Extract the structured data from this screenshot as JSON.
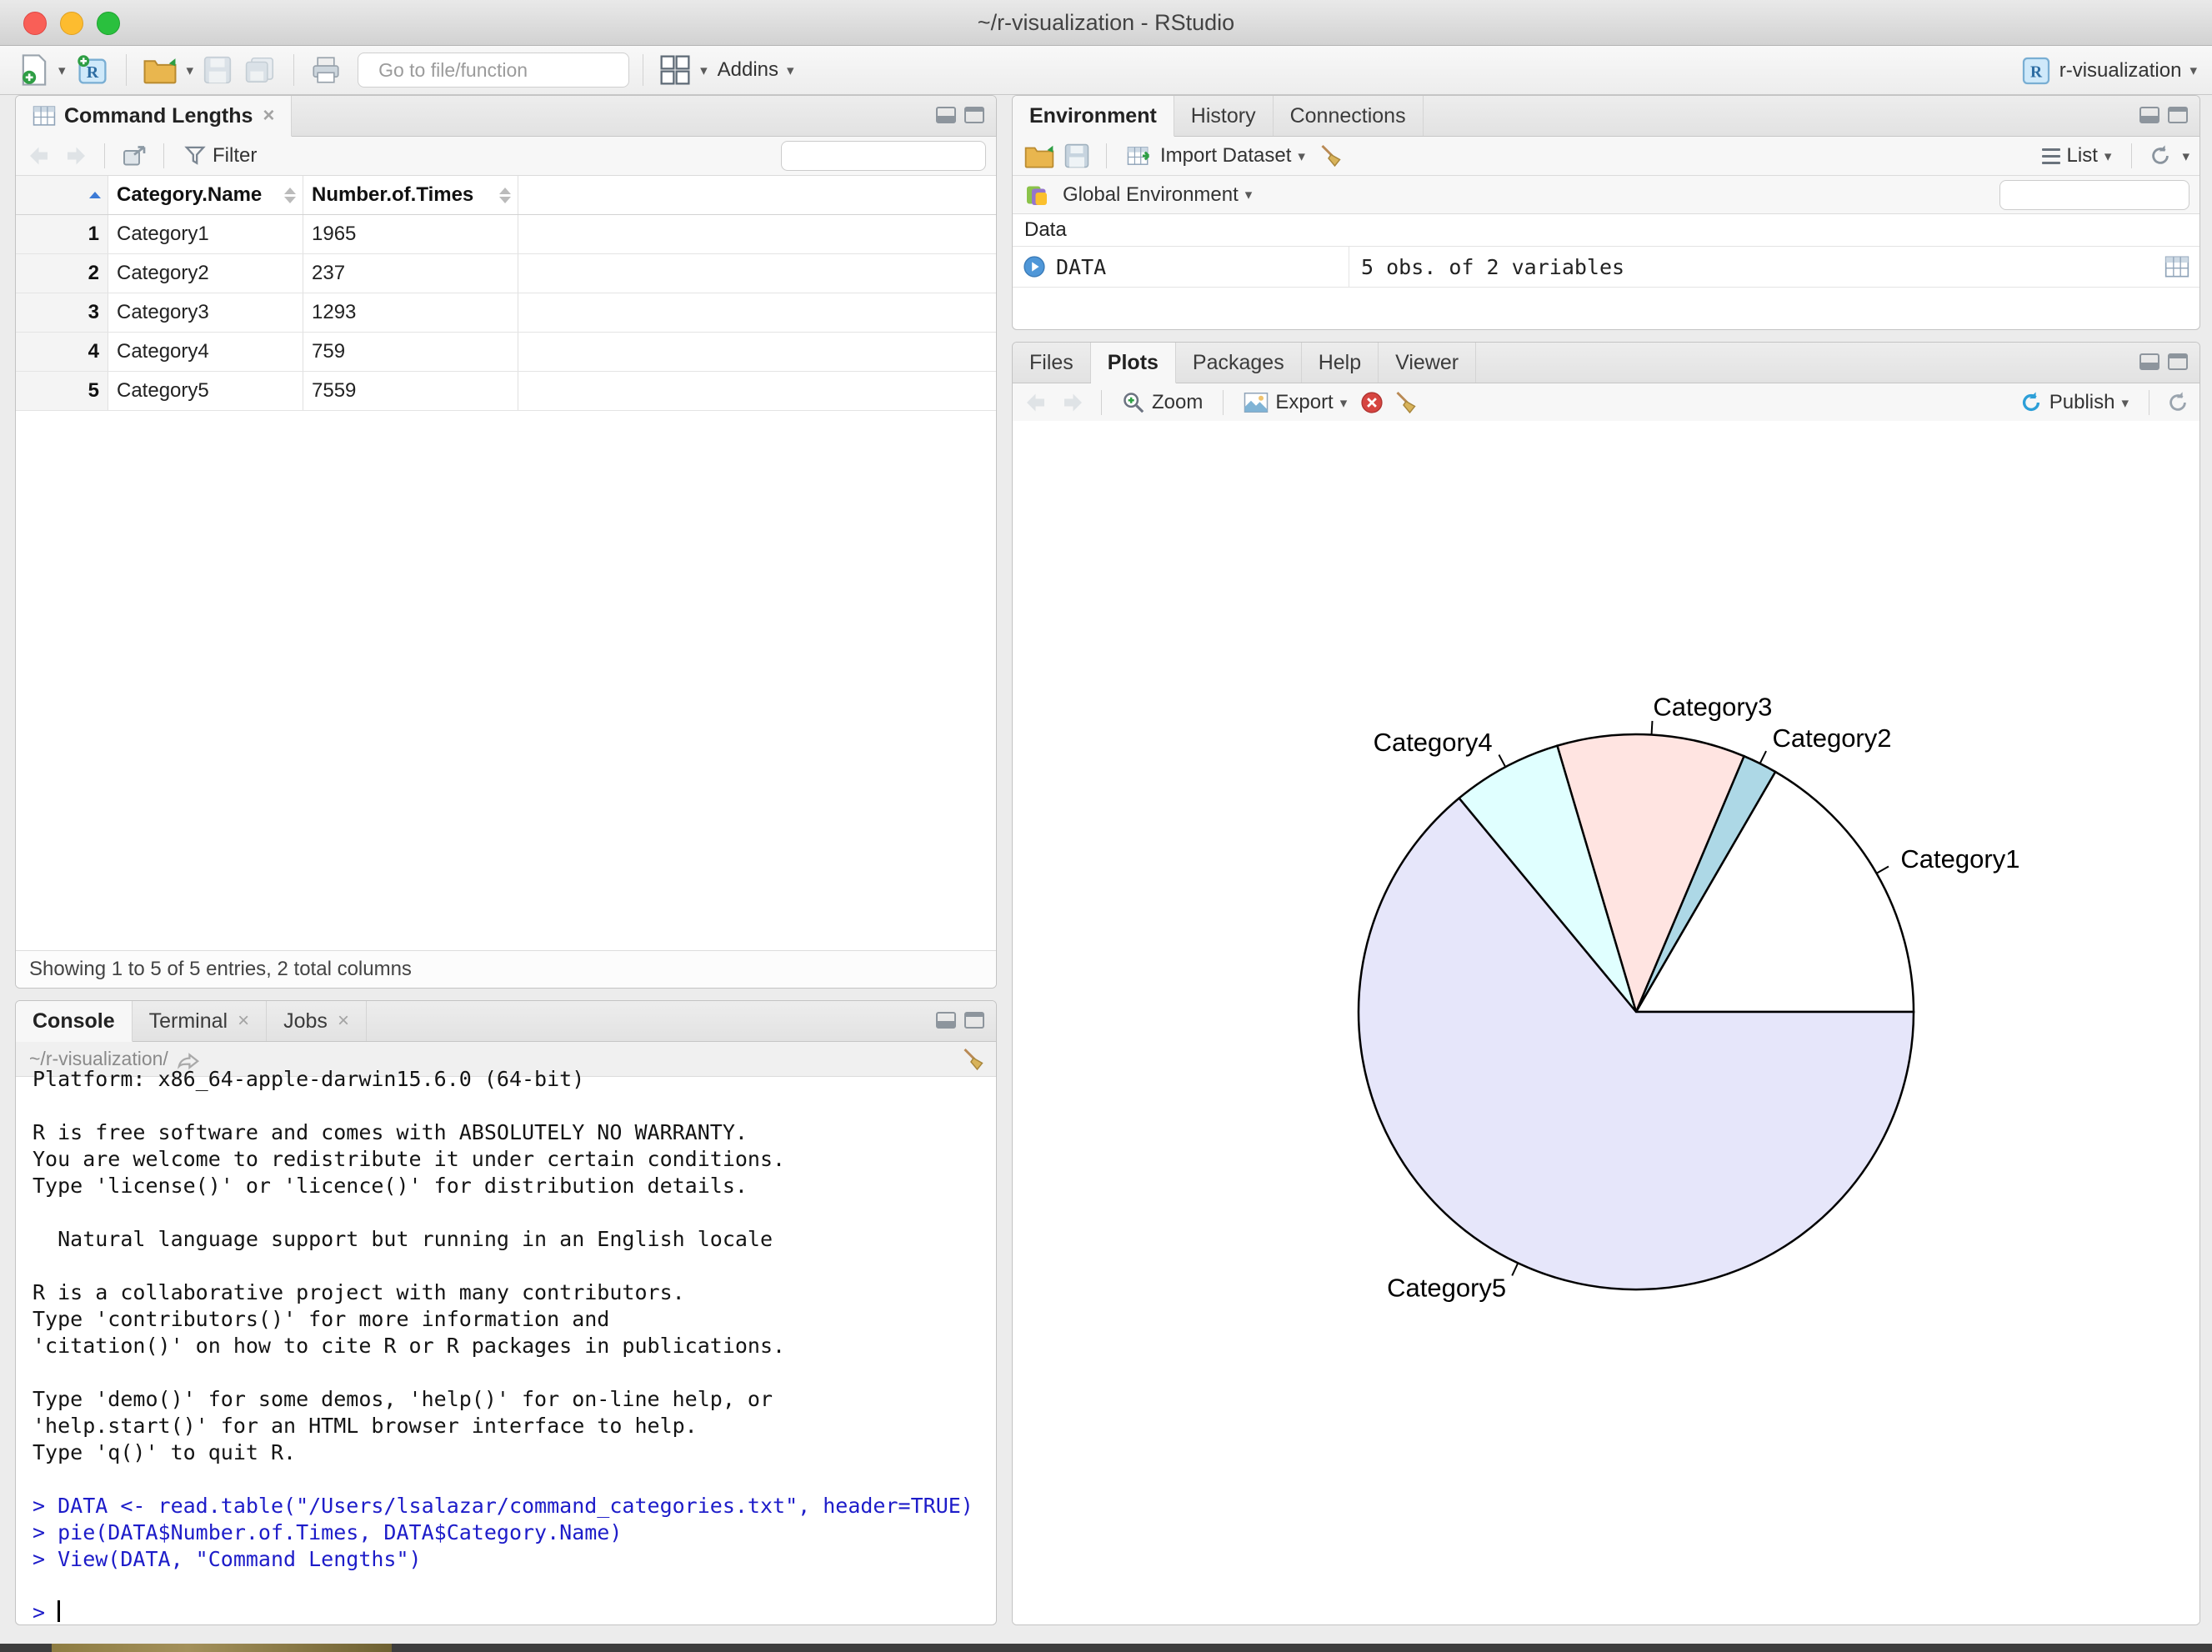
{
  "window": {
    "title": "~/r-visualization - RStudio"
  },
  "main_toolbar": {
    "goto_placeholder": "Go to file/function",
    "addins_label": "Addins",
    "project_label": "r-visualization"
  },
  "source_pane": {
    "tab_label": "Command Lengths",
    "toolbar": {
      "filter_label": "Filter"
    },
    "table": {
      "columns": [
        "Category.Name",
        "Number.of.Times"
      ],
      "rows": [
        [
          "1",
          "Category1",
          "1965"
        ],
        [
          "2",
          "Category2",
          "237"
        ],
        [
          "3",
          "Category3",
          "1293"
        ],
        [
          "4",
          "Category4",
          "759"
        ],
        [
          "5",
          "Category5",
          "7559"
        ]
      ]
    },
    "status_text": "Showing 1 to 5 of 5 entries, 2 total columns"
  },
  "environment_pane": {
    "tabs": [
      "Environment",
      "History",
      "Connections"
    ],
    "toolbar": {
      "import_label": "Import Dataset",
      "list_label": "List"
    },
    "scope_label": "Global Environment",
    "section_label": "Data",
    "objects": [
      {
        "name": "DATA",
        "value": "5 obs. of 2 variables"
      }
    ]
  },
  "plots_pane": {
    "tabs": [
      "Files",
      "Plots",
      "Packages",
      "Help",
      "Viewer"
    ],
    "toolbar": {
      "zoom_label": "Zoom",
      "export_label": "Export",
      "publish_label": "Publish"
    }
  },
  "console_pane": {
    "tabs": [
      "Console",
      "Terminal",
      "Jobs"
    ],
    "working_dir": "~/r-visualization/",
    "lines": [
      {
        "text": "Platform: x86_64-apple-darwin15.6.0 (64-bit)",
        "kind": "output"
      },
      {
        "text": "",
        "kind": "output"
      },
      {
        "text": "R is free software and comes with ABSOLUTELY NO WARRANTY.",
        "kind": "output"
      },
      {
        "text": "You are welcome to redistribute it under certain conditions.",
        "kind": "output"
      },
      {
        "text": "Type 'license()' or 'licence()' for distribution details.",
        "kind": "output"
      },
      {
        "text": "",
        "kind": "output"
      },
      {
        "text": "  Natural language support but running in an English locale",
        "kind": "output"
      },
      {
        "text": "",
        "kind": "output"
      },
      {
        "text": "R is a collaborative project with many contributors.",
        "kind": "output"
      },
      {
        "text": "Type 'contributors()' for more information and",
        "kind": "output"
      },
      {
        "text": "'citation()' on how to cite R or R packages in publications.",
        "kind": "output"
      },
      {
        "text": "",
        "kind": "output"
      },
      {
        "text": "Type 'demo()' for some demos, 'help()' for on-line help, or",
        "kind": "output"
      },
      {
        "text": "'help.start()' for an HTML browser interface to help.",
        "kind": "output"
      },
      {
        "text": "Type 'q()' to quit R.",
        "kind": "output"
      },
      {
        "text": "",
        "kind": "output"
      },
      {
        "text": "> DATA <- read.table(\"/Users/lsalazar/command_categories.txt\", header=TRUE)",
        "kind": "command"
      },
      {
        "text": "> pie(DATA$Number.of.Times, DATA$Category.Name)",
        "kind": "command"
      },
      {
        "text": "> View(DATA, \"Command Lengths\")",
        "kind": "command"
      },
      {
        "text": "",
        "kind": "output"
      },
      {
        "text": "> ",
        "kind": "prompt"
      }
    ]
  },
  "chart_data": {
    "type": "pie",
    "categories": [
      "Category1",
      "Category2",
      "Category3",
      "Category4",
      "Category5"
    ],
    "values": [
      1965,
      237,
      1293,
      759,
      7559
    ],
    "colors": [
      "#FFFFFF",
      "#ADD8E6",
      "#FFE4E1",
      "#E0FFFF",
      "#E6E6FA"
    ],
    "start_angle_deg": 0,
    "direction": "counterclockwise",
    "outline_color": "#000000",
    "label_color": "#000000"
  }
}
